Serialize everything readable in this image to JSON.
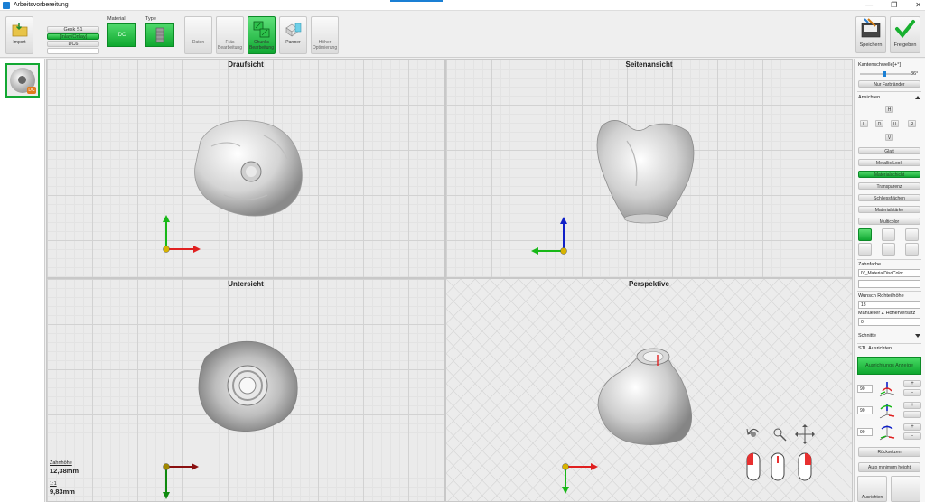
{
  "window": {
    "title": "Arbeitsvorbereitung",
    "controls": {
      "minimize": "—",
      "restore": "❐",
      "close": "✕"
    }
  },
  "toolbar": {
    "import_label": "Import",
    "lines": [
      {
        "label": "Gesk S1",
        "state": "normal"
      },
      {
        "label": "[Inlay/Onlay]",
        "state": "selected"
      },
      {
        "label": "DC6",
        "state": "normal"
      },
      {
        "label": "-",
        "state": "blank"
      }
    ],
    "material_caption": "Material",
    "material_value": "DC",
    "type_caption": "Type",
    "buttons": [
      {
        "label": "Daten",
        "icon": "data-icon"
      },
      {
        "label": "Fräs\nBearbeitung",
        "icon": "milling-icon"
      },
      {
        "label": "Chunks\nBearbeitung",
        "icon": "chunks-icon"
      },
      {
        "label": "Parmer",
        "icon": "parmer-icon"
      },
      {
        "label": "Höher\nOptimierung",
        "icon": "height-optimize-icon"
      }
    ],
    "save_label": "Speichern",
    "release_label": "Freigeben"
  },
  "viewports": {
    "top": "Draufsicht",
    "side": "Seitenansicht",
    "bottom": "Untersicht",
    "perspective": "Perspektive"
  },
  "measurements": {
    "height_caption": "Zahnhöhe",
    "height_value": "12,38mm",
    "width_caption": "1:1",
    "width_value": "9,83mm"
  },
  "right_panel": {
    "edge_threshold_label": "Kantenschwelle[+°]",
    "edge_threshold_value": "36°",
    "color_edges_label": "Nur Farbränder",
    "views_label": "Ansichten",
    "view_buttons": {
      "h": "H",
      "l": "L",
      "d": "D",
      "u": "U",
      "r": "R",
      "v": "V"
    },
    "render_modes": [
      {
        "label": "Glatt",
        "state": "normal"
      },
      {
        "label": "Metallic Look",
        "state": "normal"
      },
      {
        "label": "Materialschicht",
        "state": "active"
      },
      {
        "label": "Transparenz",
        "state": "normal"
      },
      {
        "label": "Schliessflächen",
        "state": "normal"
      },
      {
        "label": "Materialstärke",
        "state": "normal"
      },
      {
        "label": "Multicolor",
        "state": "normal"
      }
    ],
    "tooth_color_label": "Zahnfarbe",
    "tooth_color_value": "IV_MaterialDiscColor",
    "tooth_color_second": "-",
    "raw_height_label": "Wunsch Rohteilhöhe",
    "raw_height_value": "18",
    "z_offset_label": "Manueller Z Höherversatz",
    "z_offset_value": "0",
    "layer_label": "Schnitte",
    "stl_label": "STL Ausrichten",
    "alignment_display_label": "Ausrichtungs Anzeige",
    "rotations": [
      {
        "value": "90",
        "plus": "+",
        "minus": "-"
      },
      {
        "value": "90",
        "plus": "+",
        "minus": "-"
      },
      {
        "value": "90",
        "plus": "+",
        "minus": "-"
      }
    ],
    "reset_label": "Rücksetzen",
    "auto_height_label": "Auto minimum height",
    "bottom_left_label": "Ausrichten",
    "bottom_right_label": ""
  },
  "colors": {
    "accent_green": "#13a833",
    "axis_red": "#e02020",
    "axis_green": "#18b818",
    "axis_blue": "#1020c8",
    "origin_yellow": "#d8b400"
  }
}
